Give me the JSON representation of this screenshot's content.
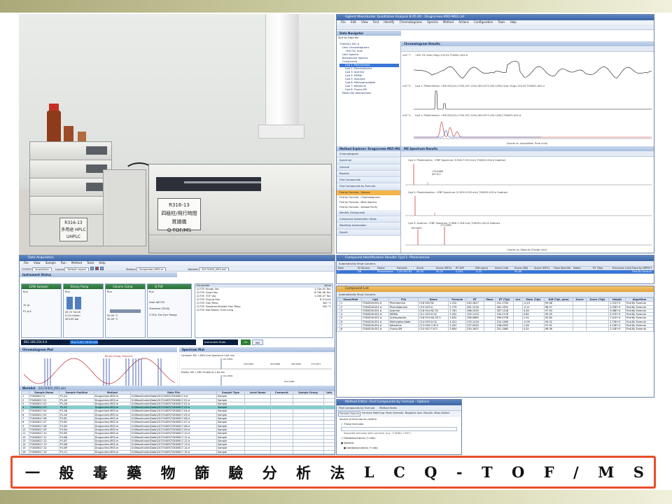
{
  "caption": {
    "chars": [
      "一",
      "般",
      "毒",
      "藥",
      "物",
      "篩",
      "驗",
      "分",
      "析",
      "法",
      "L",
      "C",
      "Q",
      "-",
      "T",
      "O",
      "F",
      "/",
      "M",
      "S"
    ]
  },
  "photo": {
    "lc_label_line1": "R316-13",
    "lc_label_line2": "多用途 HPLC",
    "lc_label_line3": "UHPLC",
    "qtof_label_line1": "R316-13",
    "qtof_label_line2": "四極柱/飛行時間",
    "qtof_label_line3": "質譜儀",
    "qtof_label_line4": "Q-TOF/MS"
  },
  "qual_window": {
    "title": "Agilent MassHunter Qualitative Analysis B.05.00 - Drugscreen-MS5-MS2.cef",
    "menu": [
      "File",
      "Edit",
      "View",
      "Find",
      "Identify",
      "Chromatograms",
      "Spectra",
      "Method",
      "Actions",
      "Configuration",
      "Tools",
      "Help"
    ],
    "data_navigator": "Data Navigator",
    "sort_label": "Sort by Data file",
    "tree": [
      "TOX0001-001.d",
      "User Chromatograms",
      "+ESI TIC Scan",
      "User Spectra",
      "Background Spectra",
      "Compounds",
      "Cpd 1: Pheniramine",
      "Cpd 2: Phenindamine",
      "Cpd 3: Acarinol",
      "Cpd 4: MDMA",
      "Cpd 5: Sulpiride",
      "Cpd 6: Methylphenidate",
      "Cpd 7: Ketamine",
      "Cpd 8: Fluoro-SM",
      "Molecular Abstractions"
    ],
    "chromatogram_results": "Chromatogram Results",
    "trace1_label": "+ESI TIC Scan Frag=125.0V TOX001-002.d",
    "trace2_label": "Cpd 1: Pheniramine: +ESI EIC(241.1700,197.1104,169.1073,154.1030) Scan Frag=125.0V TOX001-002.d",
    "trace3_label": "Cpd 1: Pheniramine: +ESI EIC(241.1700,197.1104,169.1073,154.1030) TOX001-002.d",
    "x_axis_caption": "Counts vs. Acquisition Time (min)",
    "y_scale_1": "x10^7",
    "y_scale_2": "x10^5",
    "y_scale_3": "x10^4",
    "method_explorer": "Method Explorer: Drugscreen-MS5-MS2.m",
    "explorer_items": [
      "Chromatogram",
      "Spectrum",
      "General",
      "Reports",
      "Find Compounds",
      "Find Compounds by Formula"
    ],
    "explorer_active": "Find by Formula - Options",
    "explorer_subitems": [
      "Find by Formula - Chromatograms",
      "Find by Formula - Mass Spectra",
      "Find by Formula - Sample Purity"
    ],
    "explorer_items2": [
      "Identify Compounds",
      "Compound Automation Steps",
      "Workflow Automation",
      "Export"
    ],
    "ms_results": "MS Spectrum Results",
    "spec1_label": "Cpd 1: Pheniramine: +FBF Spectrum (5.926-7.915 min) TOX001-002.d  Subtract",
    "spec1_peak": "170.0468",
    "spec1_peak_b": "(M+H)+",
    "spec2_label": "Cpd 2: Phenindamine: +FBF Spectrum (5.399-5.520 min) TOX001-002.d  Subtract",
    "spec3_label": "Cpd 3: Acarinol: +FBF Spectrum (7.686-7.916 min) TOX001-002.d  Subtract",
    "spec3_peak_a": "103.0632",
    "spec3_peak_b": "177.0993",
    "spec_x_caption": "Counts vs. Mass-to-Charge (m/z)"
  },
  "acq_window": {
    "title": "Data Acquisition",
    "menu": [
      "File",
      "View",
      "Sample",
      "Run",
      "Method",
      "Tools",
      "Help"
    ],
    "context_label": "Context",
    "context_value": "Acquisition",
    "layout_label": "Layout",
    "layout_value": "Default Layout",
    "method_label": "Method",
    "method_value": "Drugscreen-MS5.m",
    "worklist_label": "Worklist",
    "worklist_value": "20170405_MS5.wkl",
    "instrument_status": "Instrument Status",
    "modules": [
      {
        "name": "1290 Sampler",
        "state": "Run"
      },
      {
        "name": "Binary Pump",
        "state": "Run"
      },
      {
        "name": "Column Comp.",
        "state": "Run"
      },
      {
        "name": "Q-TOF",
        "state": "Run"
      }
    ],
    "sampler_vol": "10 µL",
    "sampler_pos": "P1-A-4",
    "pump_pressure": "45.72",
    "pump_pressure_b": "54.28",
    "pump_flow": "0.20 ml/min",
    "pump_bar": "403.99 bar",
    "col_temp_left": "50.00 °C",
    "col_temp_right": "50.00 °C",
    "qtof_mode": "Dual AJS ESI",
    "qtof_range": "Standard (3200)",
    "qtof_range_b": "2 GHz, Ext Dyn Range",
    "param_headers": [
      "Parameter",
      "Value"
    ],
    "params": [
      [
        "Q-TOF: Rough Vac",
        "1.74e-05 Torr"
      ],
      [
        "Q-TOF: Quad Vac",
        "8.79E-06 Torr"
      ],
      [
        "Q-TOF: TOF Vac",
        "1.03E-07 Torr"
      ],
      [
        "Q-TOF: Drying Gas",
        "8.0 l/min"
      ],
      [
        "Q-TOF: Gas Temp",
        "300 °C"
      ],
      [
        "Q-TOF: Vaporizer/Sheath Gas Temp",
        "350 °C"
      ],
      [
        "Q-TOF: Not Ready: Tune Long",
        ""
      ]
    ],
    "instrument_bar": "B02.166.254.0.0",
    "run_chip": "Run 2.04 / 16.00 min",
    "instrument_state_label": "Instrument State",
    "state_on": "On",
    "state_idle": "Idle",
    "chromatogram_plot": "Chromatogram Plot",
    "chromatogram_legend": "Binary Pump: Pressure",
    "spectrum_plot": "Spectrum Plot",
    "spec_plot_1": "Centroid: MS   +-MS1 Line Spectrum 1.64 min",
    "spec_plot_2": "Profile: MS   +-MS1 Profile at 1.64 min",
    "spec_peaks": [
      "121.0509",
      "229.0987",
      "922.0098",
      "329.0984",
      "565.0692",
      "772.2877",
      "922.0098"
    ],
    "worklist_title": "Worklist",
    "worklist_file": "20170405_MS5.wkl",
    "columns": [
      "",
      "Sample Name",
      "Sample Position",
      "Method",
      "Data File",
      "Sample Type",
      "Level Name",
      "Comment",
      "Sample Group",
      "Info."
    ],
    "rows": [
      [
        "1",
        "TOX00617-V",
        "P1-A4",
        "Drugscreen-MS5.m",
        "D:\\MassHunter\\Data\\20170405\\TOX00617-V.d",
        "Sample",
        "",
        "",
        "",
        ""
      ],
      [
        "2",
        "TOX00617-01",
        "P1-A5",
        "Drugscreen-MS5.m",
        "D:\\MassHunter\\Data\\20170405\\TOX00617-01.d",
        "Sample",
        "",
        "",
        "",
        ""
      ],
      [
        "3",
        "TOX00617-02",
        "P1-A6",
        "Drugscreen-MS5.m",
        "D:\\MassHunter\\Data\\20170405\\TOX00617-02.d",
        "Sample",
        "",
        "",
        "",
        ""
      ],
      [
        "4",
        "TOX00617-03",
        "P1-A7",
        "Drugscreen-MS5.m",
        "D:\\MassHunter\\Data\\20170405\\TOX00617-03.d",
        "Sample",
        "",
        "",
        "",
        ""
      ],
      [
        "5",
        "TOX00617-04",
        "P1-A8",
        "Drugscreen-MS5.m",
        "D:\\MassHunter\\Data\\20170405\\TOX00617-04.d",
        "Sample",
        "",
        "",
        "",
        ""
      ],
      [
        "6",
        "TOX00617-05",
        "P1-A9",
        "Drugscreen-MS5.m",
        "D:\\MassHunter\\Data\\20170405\\TOX00617-05.d",
        "Sample",
        "",
        "",
        "",
        ""
      ],
      [
        "7",
        "TOX00617-06",
        "P1-B1",
        "Drugscreen-MS5.m",
        "D:\\MassHunter\\Data\\20170405\\TOX00617-06.d",
        "Sample",
        "",
        "",
        "",
        ""
      ],
      [
        "8",
        "TOX00617-07",
        "P1-B2",
        "Drugscreen-MS5.m",
        "D:\\MassHunter\\Data\\20170405\\TOX00617-07.d",
        "Sample",
        "",
        "",
        "",
        ""
      ],
      [
        "9",
        "TOX00617-08",
        "P1-B3",
        "Drugscreen-MS5.m",
        "D:\\MassHunter\\Data\\20170405\\TOX00617-08.d",
        "Sample",
        "",
        "",
        "",
        ""
      ],
      [
        "10",
        "TOX00617-09",
        "P1-B4",
        "Drugscreen-MS5.m",
        "D:\\MassHunter\\Data\\20170405\\TOX00617-09.d",
        "Sample",
        "",
        "",
        "",
        ""
      ],
      [
        "11",
        "TOX00617-10",
        "P1-B5",
        "Drugscreen-MS5.m",
        "D:\\MassHunter\\Data\\20170405\\TOX00617-10.d",
        "Sample",
        "",
        "",
        "",
        ""
      ],
      [
        "12",
        "TOX00617-11",
        "P1-B6",
        "Drugscreen-MS5.m",
        "D:\\MassHunter\\Data\\20170405\\TOX00617-11.d",
        "Sample",
        "",
        "",
        "",
        ""
      ],
      [
        "13",
        "TOX00617-12",
        "P1-B7",
        "Drugscreen-MS5.m",
        "D:\\MassHunter\\Data\\20170405\\TOX00617-12.d",
        "Sample",
        "",
        "",
        "",
        ""
      ],
      [
        "14",
        "TOX00617-13",
        "P1-B8",
        "Drugscreen-MS5.m",
        "D:\\MassHunter\\Data\\20170405\\TOX00617-13.d",
        "Sample",
        "",
        "",
        "",
        ""
      ],
      [
        "15",
        "TOX00617-14",
        "P1-B9",
        "Drugscreen-MS5.m",
        "D:\\MassHunter\\Data\\20170405\\TOX00617-14.d",
        "Sample",
        "",
        "",
        "",
        ""
      ],
      [
        "16",
        "TOX00617-15",
        "P1-C1",
        "Drugscreen-MS5.m",
        "D:\\MassHunter\\Data\\20170405\\TOX00617-15.d",
        "Sample",
        "",
        "",
        "",
        ""
      ]
    ],
    "selected_row_index": 3
  },
  "ident_window": {
    "title": "Compound Identification Results: Cpd 1: Pheniramine",
    "toolbar": "Automatically Show Columns",
    "headers": [
      "Best",
      "ID Source",
      "Name",
      "Formula",
      "Score",
      "Score (MFG)",
      "RT Diff",
      "Diff (ppm)",
      "Score (Lib)",
      "Score (DB)",
      "Score (MFG)",
      "Food Specifie",
      "Notes",
      "RT (Tgt)",
      "Precursor (m/z)",
      "Food by NPPM Product Ion"
    ],
    "row": [
      "✓",
      "DB",
      "Pheniramine",
      "C16 H20 N2",
      "90.25",
      "90.25",
      "0.003",
      "-0.23",
      "",
      "99.08",
      "",
      "",
      "",
      "",
      "",
      "Find By Formula"
    ]
  },
  "compound_list": {
    "title": "Compound List",
    "toolbar": "Automatically Show Columns",
    "headers": [
      "",
      "Show/Hide",
      "Cpd",
      "File",
      "Name",
      "Formula",
      "RT",
      "Mass",
      "RT (Tgt)",
      "m/z",
      "Mass (Tgt)",
      "Diff (Tgt, ppm)",
      "Score",
      "Score (Tgt)",
      "Height",
      "Algorithm"
    ],
    "rows": [
      [
        "1",
        "TOX0026-001.d",
        "Pheniramine",
        "C16 H20 N2",
        "1.312",
        "240.1627",
        "",
        "241.1700",
        "",
        "-0.19",
        "99.08",
        "",
        "",
        "1.31E+5",
        "Find By Formula"
      ],
      [
        "2",
        "TOX0026-001.d",
        "Phenindamine",
        "C19 H19 N",
        "2.779",
        "261.1518",
        "",
        "262.1591",
        "",
        "-0.11",
        "98.57",
        "",
        "",
        "2.53E+5",
        "Find By Formula"
      ],
      [
        "3",
        "TOX0026-001.d",
        "Acarinol",
        "C16 H14 N2 O2",
        "7.761",
        "266.1055",
        "",
        "267.1128",
        "",
        "0.28",
        "97.94",
        "",
        "",
        "5.08E+4",
        "Find By Formula"
      ],
      [
        "4",
        "TOX0026-001.d",
        "MDMA",
        "C11 H15 N O2",
        "3.452",
        "193.1103",
        "",
        "194.1176",
        "",
        "0.85",
        "99.09",
        "",
        "",
        "2.07E+5",
        "Find By Formula"
      ],
      [
        "5",
        "TOX0026-001.d",
        "Sulfasalazine",
        "C18 H14 N4 O5 S",
        "7.832",
        "398.0685",
        "",
        "399.0758",
        "",
        "1.04",
        "95.84",
        "",
        "",
        "7.41E+4",
        "Find By Formula"
      ],
      [
        "6",
        "TOX0026-001.d",
        "Methylphenidate",
        "C14 H19 N O2",
        "4.021",
        "233.1416",
        "",
        "234.1489",
        "",
        "-0.09",
        "99.52",
        "",
        "",
        "1.79E+5",
        "Find By Formula"
      ],
      [
        "7",
        "TOX0026-001.d",
        "Ketamine",
        "C13 H16 Cl N O",
        "3.187",
        "237.0920",
        "",
        "238.0993",
        "",
        "1.28",
        "97.91",
        "",
        "",
        "4.10E+4",
        "Find By Formula"
      ],
      [
        "8",
        "TOX0026-001.d",
        "Fluoro-SM",
        "C15 H21 F N O",
        "3.894",
        "250.1607",
        "",
        "251.1680",
        "",
        "0.34",
        "98.56",
        "",
        "",
        "1.04E+5",
        "Find By Formula"
      ]
    ]
  },
  "method_editor": {
    "title": "Method Editor: Find Compounds by Formula - Options",
    "toolbar": "Find Compounds by Formula",
    "method_items_label": "Method Items",
    "tabs": [
      "Formula Source",
      "Formula Matching",
      "Peak Intensity",
      "Negative Ions",
      "Results",
      "Mass Defect"
    ],
    "source_label": "Source of formulas to confirm",
    "option1": "These formulas:",
    "hint": "Separate formulas with commas (e.g. \"C3H8O, CH4\")",
    "option2": "Database/Library (*.cdb):",
    "option3": "Worklist",
    "option4": "Database/Library (*.cdb)",
    "db_path": "C:\\MassHunter\\PCDL\\...\\Forensic Toxicology PCDL"
  },
  "colors": {
    "caption_border": "#e94e2a",
    "window_title": "#3c64a4",
    "accent_orange": "#f4b44a",
    "trace_black": "#111111",
    "trace_red": "#c0262b",
    "trace_blue": "#1f3fa8",
    "selected_row": "#7fd0cc"
  }
}
